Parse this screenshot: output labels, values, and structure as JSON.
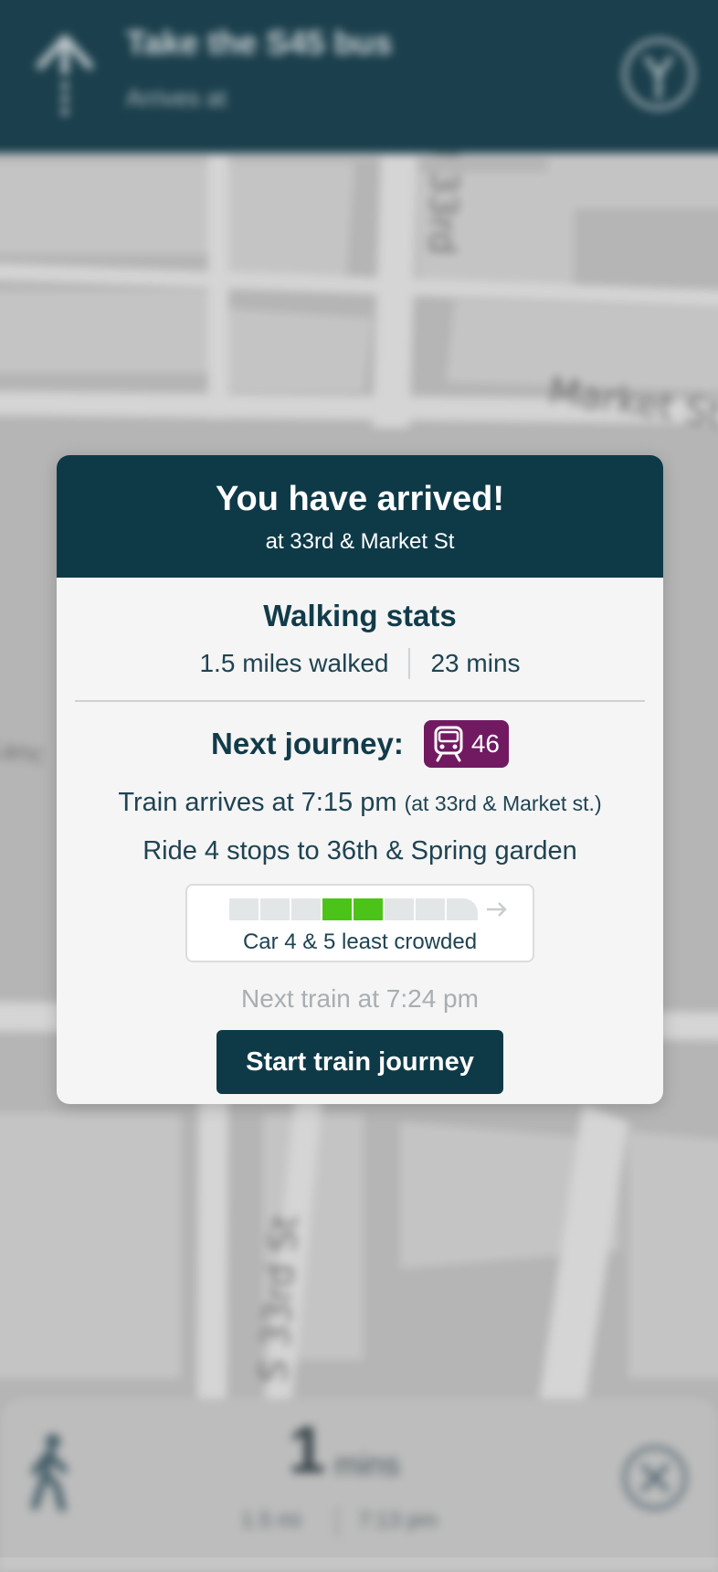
{
  "top_bar": {
    "title": "Take the S45 bus",
    "subtitle": "Arrives at",
    "icons": [
      "straight-arrow-icon",
      "fork-icon"
    ]
  },
  "map": {
    "street_labels": [
      "N 33rd",
      "Market St",
      "S 33rd St",
      "Lanc"
    ]
  },
  "bottom_bar": {
    "eta_value": "1",
    "eta_unit": "mins",
    "distance": "1.5 mi",
    "arrival_time": "7:13 pm",
    "icons": [
      "walking-person-icon",
      "close-icon"
    ]
  },
  "modal": {
    "title": "You have arrived!",
    "subtitle": "at 33rd & Market St",
    "walking_stats": {
      "title": "Walking stats",
      "distance": "1.5 miles walked",
      "duration": "23 mins"
    },
    "next_journey": {
      "label": "Next journey:",
      "route_number": "46",
      "route_color": "#711a62",
      "arrival_text": "Train arrives at 7:15 pm",
      "arrival_location": "(at 33rd & Market st.)",
      "ride_text": "Ride 4 stops to 36th & Spring garden",
      "crowding_text": "Car 4 & 5 least crowded",
      "least_crowded_cars": [
        4,
        5
      ],
      "total_cars": 8,
      "next_train": "Next train at 7:24 pm",
      "start_button": "Start train journey"
    }
  },
  "colors": {
    "primary_dark": "#0e3a48",
    "uncrowded_green": "#4cc318"
  }
}
